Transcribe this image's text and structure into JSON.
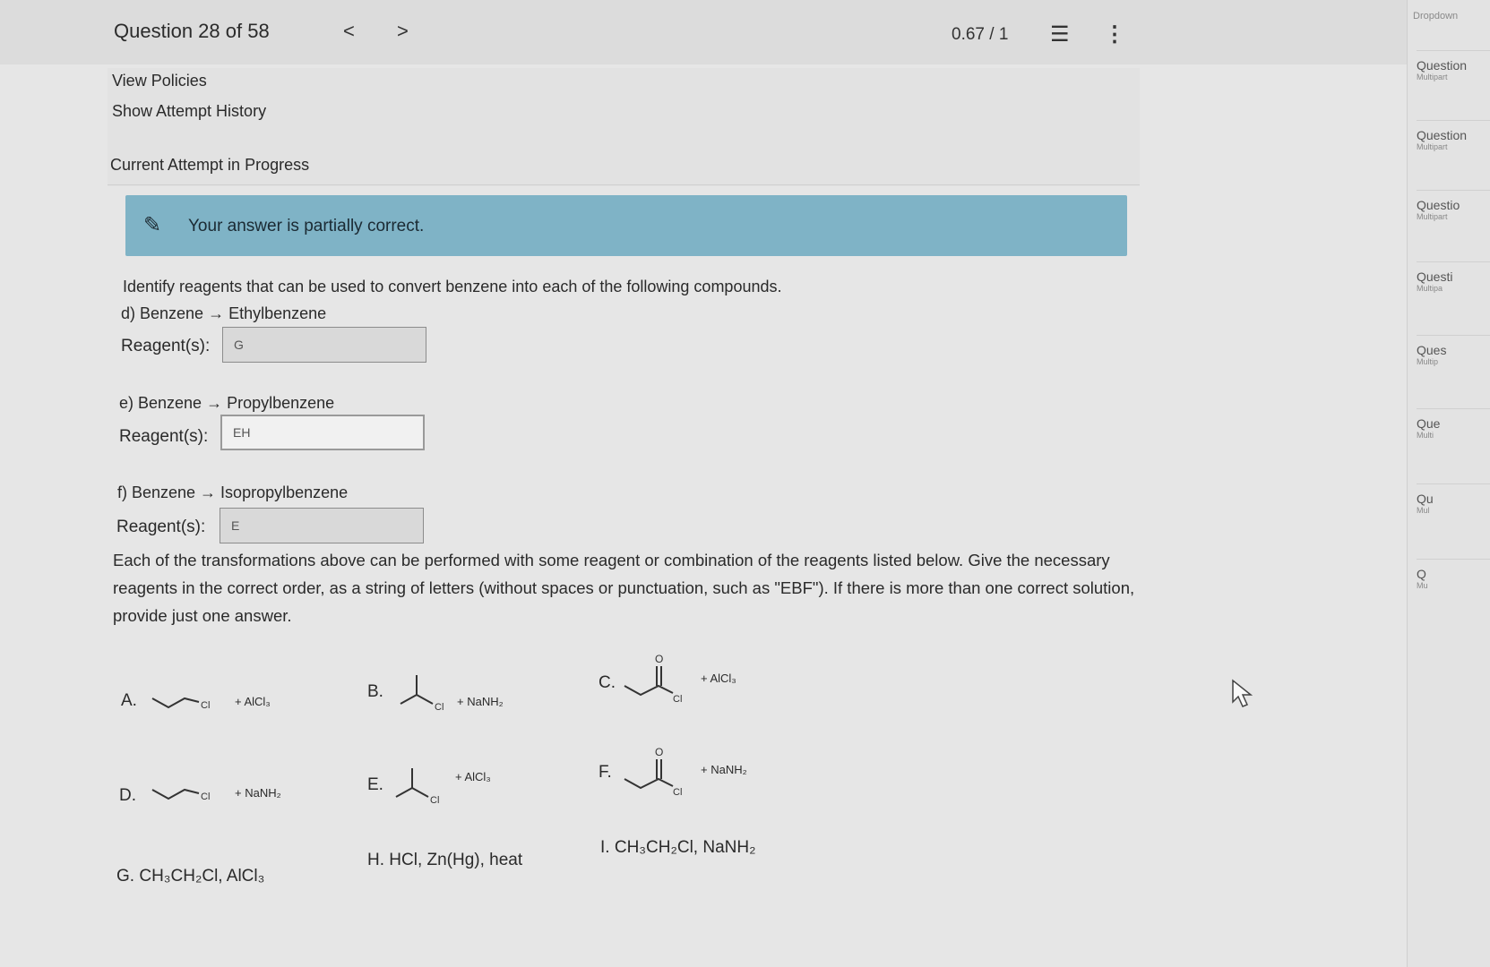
{
  "header": {
    "question_title": "Question 28 of 58",
    "prev_arrow": "<",
    "next_arrow": ">",
    "score": "0.67 / 1",
    "list_icon": "list-icon",
    "more_icon": "more-vertical-icon"
  },
  "links": {
    "view_policies": "View Policies",
    "show_attempt_history": "Show Attempt History",
    "current_attempt": "Current Attempt in Progress"
  },
  "banner": {
    "icon": "pencil-icon",
    "text": "Your answer is partially correct.",
    "color": "#7fb3c6"
  },
  "question": {
    "intro": "Identify reagents that can be used to convert benzene into each of the following compounds.",
    "parts": [
      {
        "title": "d) Benzene → Ethylbenzene",
        "label": "Reagent(s):",
        "value": "G"
      },
      {
        "title": "e) Benzene → Propylbenzene",
        "label": "Reagent(s):",
        "value": "EH"
      },
      {
        "title": "f) Benzene → Isopropylbenzene",
        "label": "Reagent(s):",
        "value": "E"
      }
    ],
    "instructions": "Each of the transformations above can be performed with some reagent or combination of the reagents listed below. Give the necessary reagents in the correct order, as a string of letters (without spaces or punctuation, such as \"EBF\"). If there is more than one correct solution, provide just one answer."
  },
  "options": {
    "A": {
      "letter": "A.",
      "reagent": "+ AlCl₃",
      "cl": "Cl"
    },
    "B": {
      "letter": "B.",
      "reagent": "+ NaNH₂",
      "cl": "Cl"
    },
    "C": {
      "letter": "C.",
      "reagent": "+ AlCl₃",
      "cl": "Cl",
      "o": "O"
    },
    "D": {
      "letter": "D.",
      "reagent": "+ NaNH₂",
      "cl": "Cl"
    },
    "E": {
      "letter": "E.",
      "reagent": "+ AlCl₃",
      "cl": "Cl"
    },
    "F": {
      "letter": "F.",
      "reagent": "+ NaNH₂",
      "cl": "Cl",
      "o": "O"
    },
    "G": {
      "letter": "G.",
      "text": "CH₃CH₂Cl, AlCl₃"
    },
    "H": {
      "letter": "H.",
      "text": "HCl, Zn(Hg), heat"
    },
    "I": {
      "letter": "I.",
      "text": "CH₃CH₂Cl, NaNH₂"
    }
  },
  "sidebar": {
    "top_label": "Dropdown",
    "items": [
      {
        "title": "Question",
        "sub": "Multipart"
      },
      {
        "title": "Question",
        "sub": "Multipart"
      },
      {
        "title": "Questio",
        "sub": "Multipart"
      },
      {
        "title": "Questi",
        "sub": "Multipa"
      },
      {
        "title": "Ques",
        "sub": "Multip"
      },
      {
        "title": "Que",
        "sub": "Multi"
      },
      {
        "title": "Qu",
        "sub": "Mul"
      },
      {
        "title": "Q",
        "sub": "Mu"
      }
    ]
  }
}
